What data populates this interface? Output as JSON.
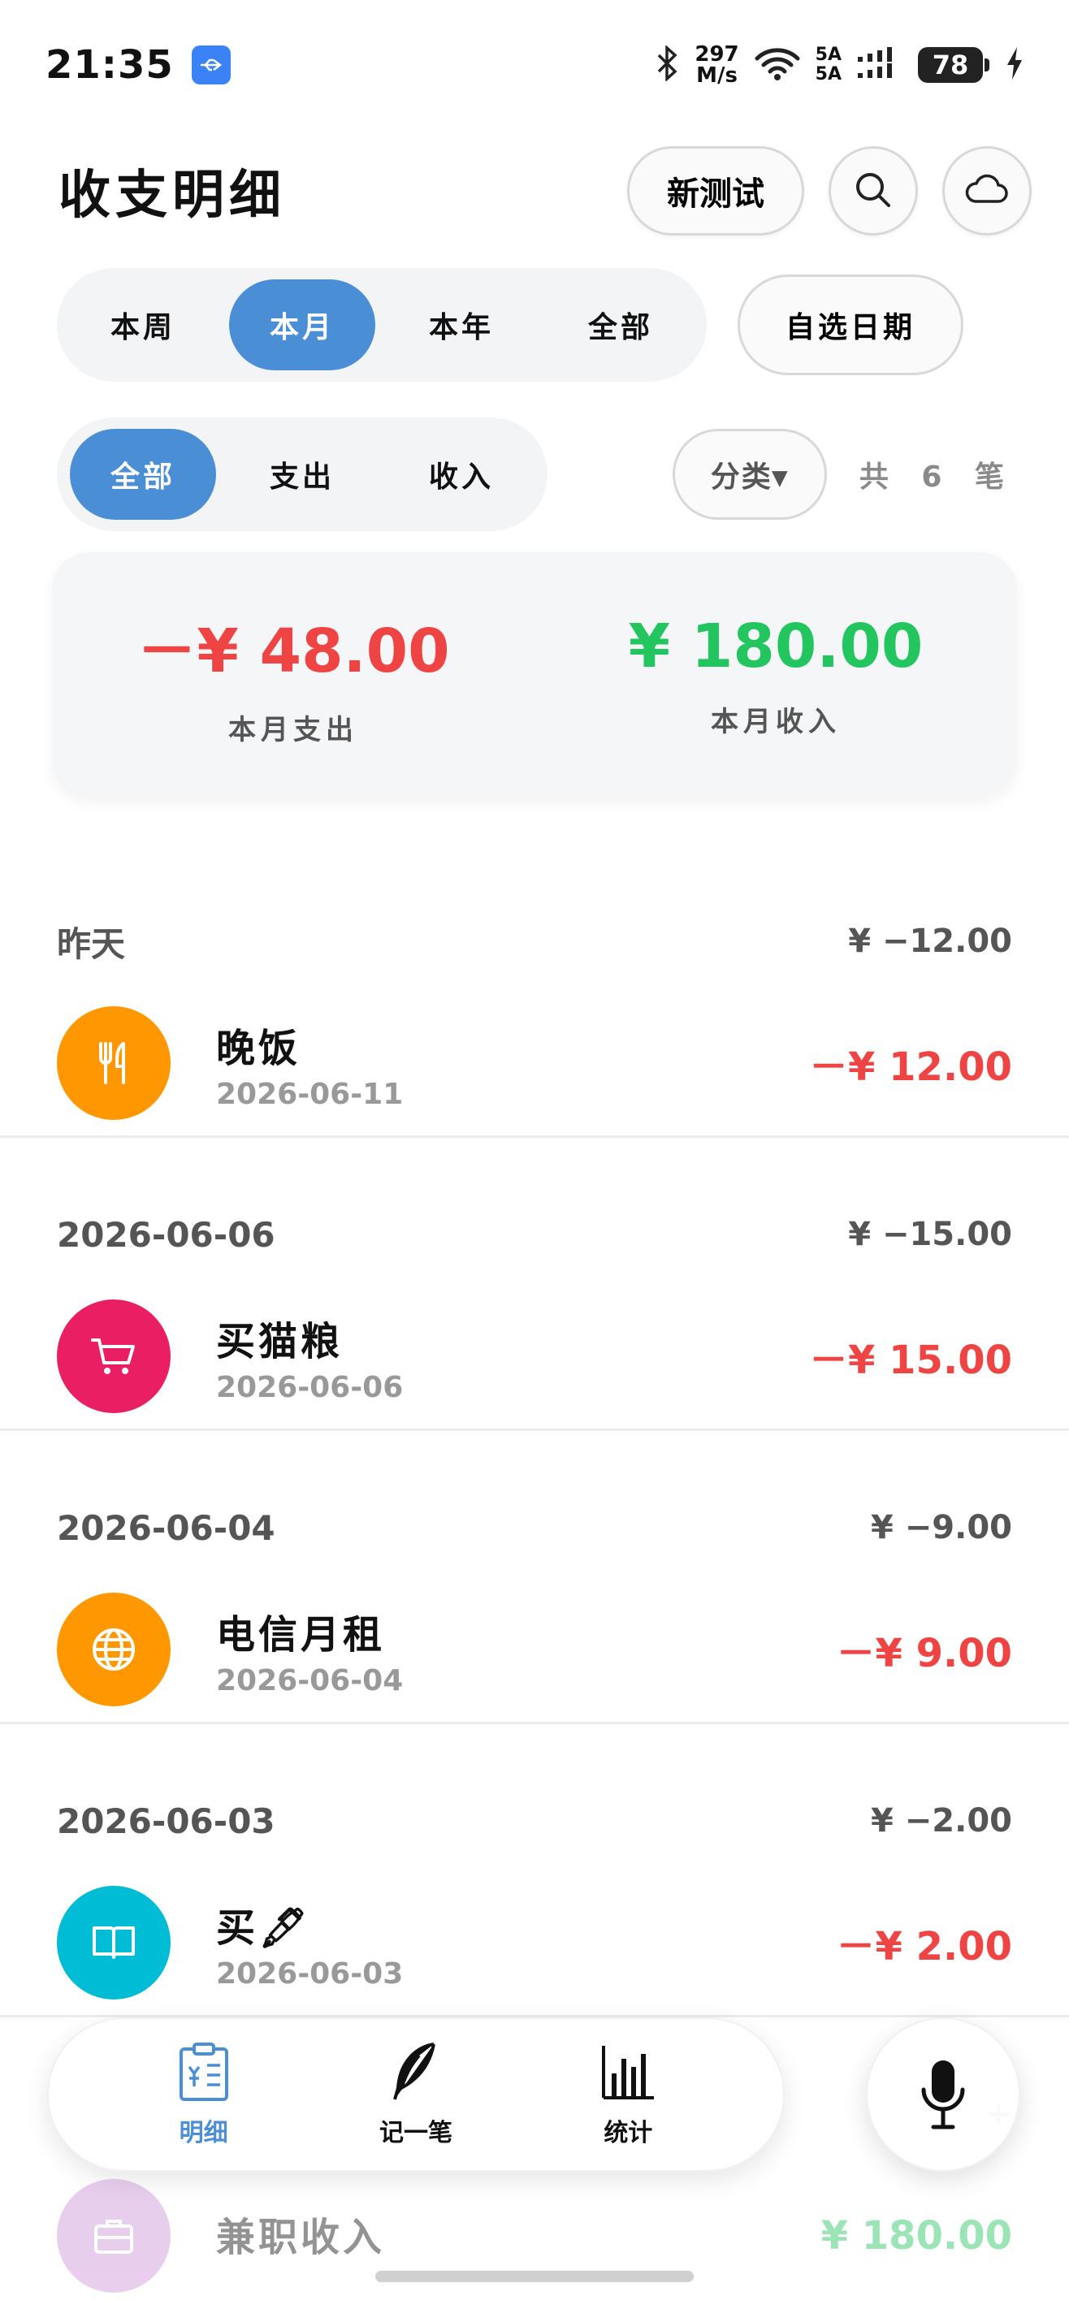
{
  "status_bar": {
    "time": "21:35",
    "net_speed_value": "297",
    "net_speed_unit": "M/s",
    "signal_1": "5A",
    "signal_2": "5A",
    "battery": "78"
  },
  "header": {
    "title": "收支明细",
    "book_label": "新测试"
  },
  "period_tabs": [
    {
      "label": "本周",
      "active": false
    },
    {
      "label": "本月",
      "active": true
    },
    {
      "label": "本年",
      "active": false
    },
    {
      "label": "全部",
      "active": false
    }
  ],
  "custom_range_label": "自选日期",
  "type_tabs": [
    {
      "label": "全部",
      "active": true
    },
    {
      "label": "支出",
      "active": false
    },
    {
      "label": "收入",
      "active": false
    }
  ],
  "category_filter_label": "分类▾",
  "record_count_label": "共 6 笔",
  "summary": {
    "expense_value": "－¥ 48.00",
    "expense_label": "本月支出",
    "income_value": "¥ 180.00",
    "income_label": "本月收入"
  },
  "groups": [
    {
      "date": "昨天",
      "total": "¥ −12.00",
      "items": [
        {
          "title": "晚饭",
          "date": "2026-06-11",
          "amount": "－¥ 12.00",
          "icon": "utensils-icon",
          "color": "#ff9800"
        }
      ]
    },
    {
      "date": "2026-06-06",
      "total": "¥ −15.00",
      "items": [
        {
          "title": "买猫粮",
          "date": "2026-06-06",
          "amount": "－¥ 15.00",
          "icon": "cart-icon",
          "color": "#e91e63"
        }
      ]
    },
    {
      "date": "2026-06-04",
      "total": "¥ −9.00",
      "items": [
        {
          "title": "电信月租",
          "date": "2026-06-04",
          "amount": "－¥ 9.00",
          "icon": "globe-icon",
          "color": "#ff9800"
        }
      ]
    },
    {
      "date": "2026-06-03",
      "total": "¥ −2.00",
      "items": [
        {
          "title": "买🖋",
          "date": "2026-06-03",
          "amount": "－¥ 2.00",
          "icon": "book-icon",
          "color": "#00bcd4"
        }
      ]
    },
    {
      "date": "",
      "total": "+",
      "items": [
        {
          "title": "兼职收入",
          "date": "",
          "amount": "¥ 180.00",
          "icon": "briefcase-icon",
          "color": "#ce93d8"
        }
      ]
    }
  ],
  "bottom_nav": [
    {
      "label": "明细",
      "icon": "clipboard-icon",
      "active": true
    },
    {
      "label": "记一笔",
      "icon": "feather-icon",
      "active": false
    },
    {
      "label": "统计",
      "icon": "bar-chart-icon",
      "active": false
    }
  ],
  "colors": {
    "accent": "#4a8fd6",
    "expense": "#ef4444",
    "income": "#22c55e"
  }
}
